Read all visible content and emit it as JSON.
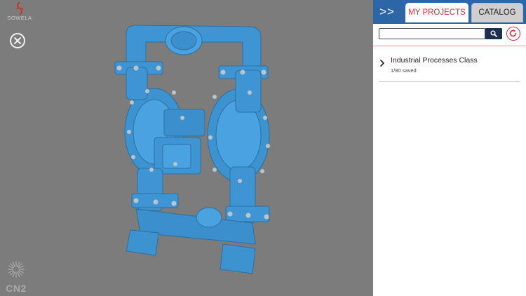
{
  "viewport": {
    "brand_top": "SOWELA",
    "brand_bottom": "CN2",
    "close_icon": "close-circle-icon",
    "model_name": "air-operated double diaphragm pump 3D model",
    "model_color": "#3f95d3"
  },
  "panel": {
    "collapse_label": ">>",
    "tabs": [
      {
        "label": "MY PROJECTS",
        "active": true
      },
      {
        "label": "CATALOG",
        "active": false
      }
    ],
    "search": {
      "value": "",
      "placeholder": ""
    },
    "search_icon": "search-icon",
    "refresh_icon": "refresh-icon",
    "projects": [
      {
        "name": "Industrial Processes Class",
        "saved": "1/80 saved"
      }
    ],
    "colors": {
      "header": "#2d66a6",
      "accent": "#d1333f",
      "search_button": "#1c2f4e"
    }
  }
}
